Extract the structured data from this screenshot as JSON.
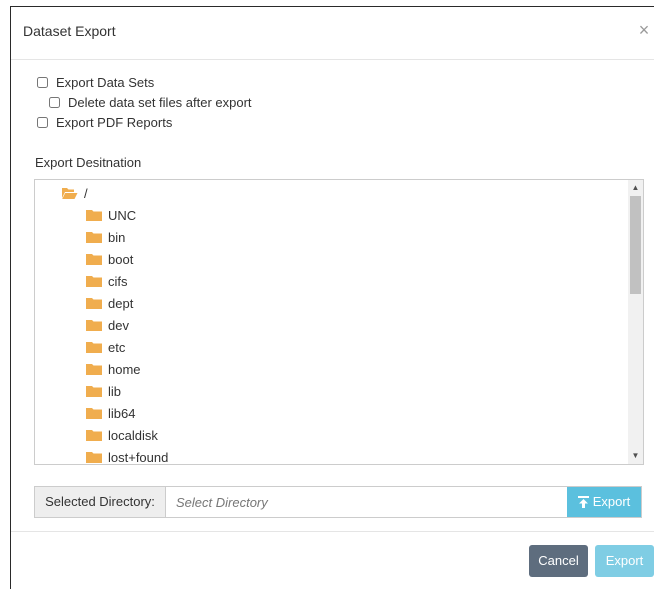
{
  "dialog": {
    "title": "Dataset Export",
    "close_glyph": "×"
  },
  "options": [
    {
      "label": "Export Data Sets",
      "checked": false
    },
    {
      "label": "Delete data set files after export",
      "checked": false
    },
    {
      "label": "Export PDF Reports",
      "checked": false
    }
  ],
  "destination": {
    "label": "Export Desitnation",
    "root": "/",
    "folders": [
      "UNC",
      "bin",
      "boot",
      "cifs",
      "dept",
      "dev",
      "etc",
      "home",
      "lib",
      "lib64",
      "localdisk",
      "lost+found"
    ]
  },
  "selected_directory": {
    "label": "Selected Directory:",
    "placeholder": "Select Directory",
    "value": "",
    "button_label": "Export"
  },
  "footer": {
    "cancel_label": "Cancel",
    "export_label": "Export"
  },
  "colors": {
    "folder": "#f0ad4e",
    "info": "#5bc0de",
    "cancel": "#5e6d7e"
  }
}
